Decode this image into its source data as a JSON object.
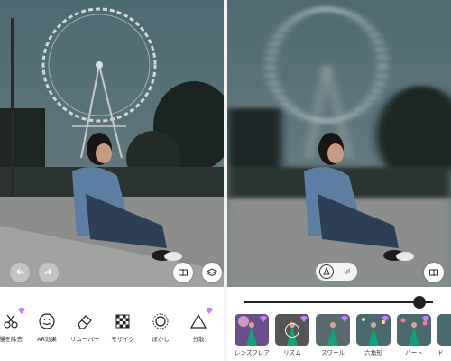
{
  "left": {
    "tools": [
      {
        "label": "漫を除去",
        "icon": "scissors-icon",
        "premium": true
      },
      {
        "label": "AR効果",
        "icon": "smiley-icon",
        "premium": false
      },
      {
        "label": "リムーバー",
        "icon": "eraser-icon",
        "premium": false
      },
      {
        "label": "モザイク",
        "icon": "mosaic-icon",
        "premium": false
      },
      {
        "label": "ぼかし",
        "icon": "blur-icon",
        "premium": false
      },
      {
        "label": "分散",
        "icon": "triangle-icon",
        "premium": true
      }
    ]
  },
  "right": {
    "slider": {
      "value": 0.93
    },
    "effects": [
      {
        "label": "レンズフレア",
        "premium": true,
        "selected": false
      },
      {
        "label": "リズム",
        "premium": true,
        "selected": true
      },
      {
        "label": "スワール",
        "premium": true,
        "selected": false
      },
      {
        "label": "六角形",
        "premium": true,
        "selected": false
      },
      {
        "label": "ハート",
        "premium": true,
        "selected": false
      },
      {
        "label": "ド",
        "premium": false,
        "selected": false
      }
    ]
  },
  "colors": {
    "sky": "#4f6a72",
    "road": "#8a8d8c",
    "accent_gem": "#c77dff",
    "thumb_teal": "#0e7f9a"
  }
}
